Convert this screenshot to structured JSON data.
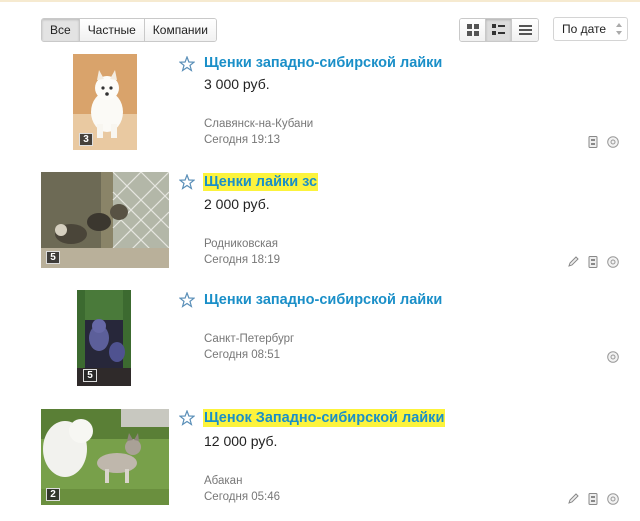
{
  "filters": {
    "all": "Все",
    "private": "Частные",
    "companies": "Компании"
  },
  "sort": {
    "selected": "По дате"
  },
  "listings": [
    {
      "title": "Щенки западно-сибирской лайки",
      "price": "3 000 руб.",
      "city": "Славянск-на-Кубани",
      "date": "Сегодня 19:13",
      "photos": "3",
      "highlighted": false,
      "icons": [
        "phone-icon",
        "delivery-icon"
      ]
    },
    {
      "title": "Щенки лайки зс",
      "price": "2 000 руб.",
      "city": "Родниковская",
      "date": "Сегодня 18:19",
      "photos": "5",
      "highlighted": true,
      "icons": [
        "pin-icon",
        "phone-icon",
        "delivery-icon"
      ]
    },
    {
      "title": "Щенки западно-сибирской лайки",
      "price": "",
      "city": "Санкт-Петербург",
      "date": "Сегодня 08:51",
      "photos": "5",
      "highlighted": false,
      "icons": [
        "delivery-icon"
      ]
    },
    {
      "title": "Щенок Западно-сибирской лайки",
      "price": "12 000 руб.",
      "city": "Абакан",
      "date": "Сегодня 05:46",
      "photos": "2",
      "highlighted": true,
      "icons": [
        "pin-icon",
        "phone-icon",
        "delivery-icon"
      ]
    }
  ],
  "colors": {
    "link": "#1a8fc8",
    "highlight": "#fcf33c",
    "muted": "#777777"
  }
}
